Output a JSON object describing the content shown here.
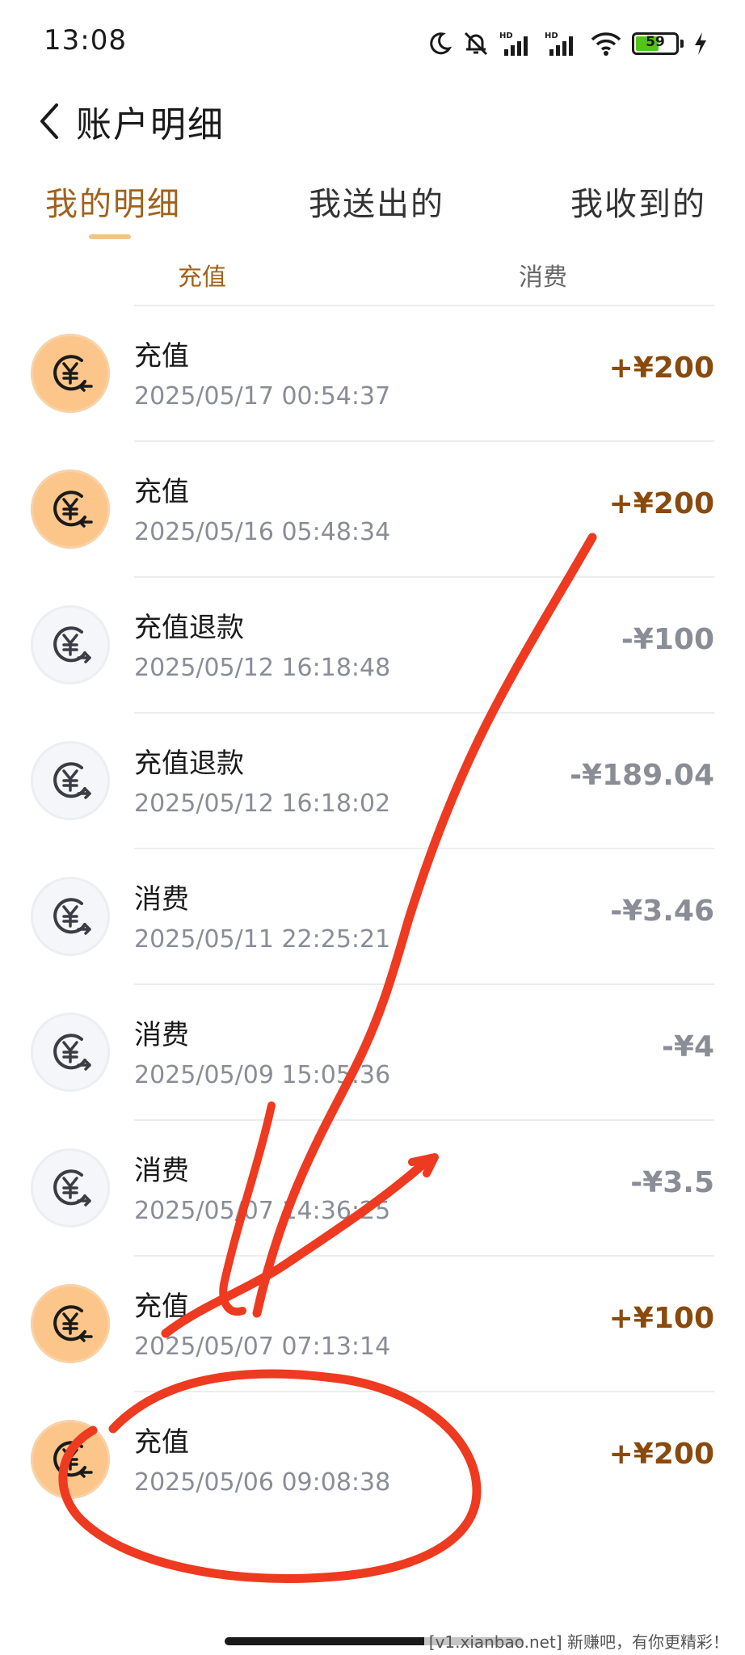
{
  "status_bar": {
    "time": "13:08",
    "battery": 59,
    "hd_label": "HD"
  },
  "header": {
    "title": "账户明细"
  },
  "tabs": [
    {
      "label": "我的明细",
      "active": true
    },
    {
      "label": "我送出的",
      "active": false
    },
    {
      "label": "我收到的",
      "active": false
    }
  ],
  "subtabs": [
    {
      "label": "充值",
      "active": true
    },
    {
      "label": "消费",
      "active": false
    }
  ],
  "transactions": [
    {
      "title": "充值",
      "time": "2025/05/17 00:54:37",
      "amount": "+¥200",
      "kind": "recharge"
    },
    {
      "title": "充值",
      "time": "2025/05/16 05:48:34",
      "amount": "+¥200",
      "kind": "recharge"
    },
    {
      "title": "充值退款",
      "time": "2025/05/12 16:18:48",
      "amount": "-¥100",
      "kind": "deduct"
    },
    {
      "title": "充值退款",
      "time": "2025/05/12 16:18:02",
      "amount": "-¥189.04",
      "kind": "deduct"
    },
    {
      "title": "消费",
      "time": "2025/05/11 22:25:21",
      "amount": "-¥3.46",
      "kind": "deduct"
    },
    {
      "title": "消费",
      "time": "2025/05/09 15:05:36",
      "amount": "-¥4",
      "kind": "deduct"
    },
    {
      "title": "消费",
      "time": "2025/05/07 14:36:25",
      "amount": "-¥3.5",
      "kind": "deduct"
    },
    {
      "title": "充值",
      "time": "2025/05/07 07:13:14",
      "amount": "+¥100",
      "kind": "recharge"
    },
    {
      "title": "充值",
      "time": "2025/05/06 09:08:38",
      "amount": "+¥200",
      "kind": "recharge"
    }
  ],
  "icons": {
    "recharge": "yen-arrow-in-icon",
    "deduct": "yen-arrow-out-icon"
  },
  "colors": {
    "accent": "#a0621c",
    "amount_plus": "#8a4a0e",
    "amount_minus": "#8a8d96",
    "recharge_icon_bg": "#fcc58a",
    "deduct_icon_bg": "#f5f6f9",
    "annotation": "#ee3a20"
  },
  "watermark": "[v1.xianbao.net] 新赚吧，有你更精彩！"
}
